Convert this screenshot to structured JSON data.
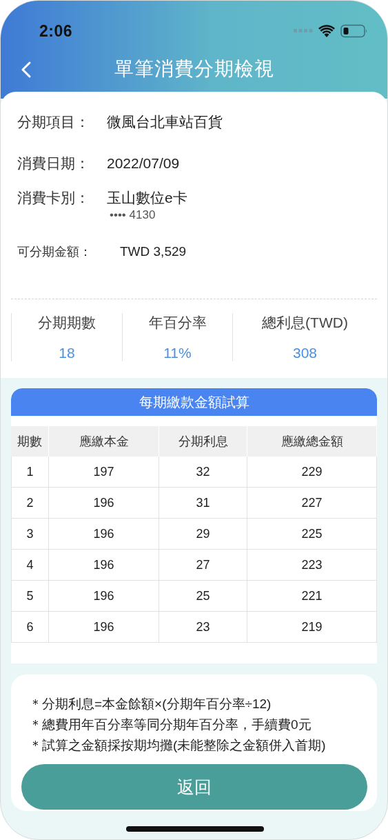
{
  "status_bar": {
    "time": "2:06"
  },
  "header": {
    "title": "單筆消費分期檢視"
  },
  "details": [
    {
      "kind": "main",
      "label": "分期項目：",
      "value": "微風台北車站百貨"
    },
    {
      "kind": "main",
      "label": "消費日期：",
      "value": "2022/07/09"
    },
    {
      "kind": "main",
      "label": "消費卡別：",
      "value": "玉山數位e卡",
      "subvalue": "•••• 4130"
    },
    {
      "kind": "amount",
      "label": "可分期金額：",
      "value": "TWD 3,529"
    }
  ],
  "summary": [
    {
      "label": "分期期數",
      "value": "18"
    },
    {
      "label": "年百分率",
      "value": "11%"
    },
    {
      "label": "總利息(TWD)",
      "value": "308"
    }
  ],
  "schedule": {
    "title": "每期繳款金額試算",
    "columns": [
      "期數",
      "應繳本金",
      "分期利息",
      "應繳總金額"
    ],
    "rows": [
      [
        "1",
        "197",
        "32",
        "229"
      ],
      [
        "2",
        "196",
        "31",
        "227"
      ],
      [
        "3",
        "196",
        "29",
        "225"
      ],
      [
        "4",
        "196",
        "27",
        "223"
      ],
      [
        "5",
        "196",
        "25",
        "221"
      ],
      [
        "6",
        "196",
        "23",
        "219"
      ]
    ]
  },
  "notes": [
    "＊分期利息=本金餘額×(分期年百分率÷12)",
    "＊總費用年百分率等同分期年百分率，手續費0元",
    "＊試算之金額採按期均攤(未能整除之金額併入首期)"
  ],
  "button": {
    "label": "返回"
  }
}
